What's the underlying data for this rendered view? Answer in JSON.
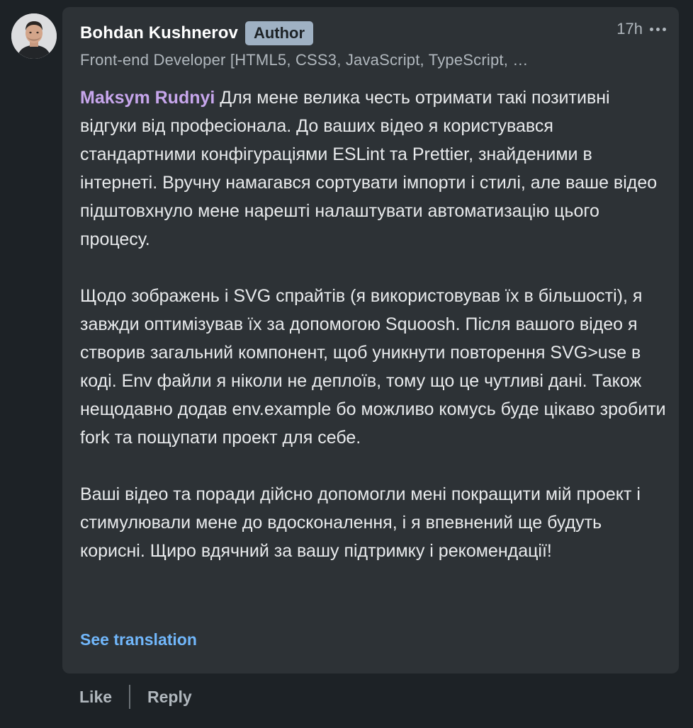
{
  "comment": {
    "author": {
      "name": "Bohdan Kushnerov",
      "badge": "Author",
      "headline": "Front-end Developer [HTML5, CSS3, JavaScript, TypeScript, …"
    },
    "timestamp": "17h",
    "mention": "Maksym Rudnyi",
    "paragraphs": [
      " Для мене велика честь отримати такі позитивні відгуки від професіонала. До ваших відео я користувався стандартними конфігураціями ESLint та Prettier, знайденими в інтернеті. Вручну намагався сортувати імпорти і стилі, але ваше відео підштовхнуло мене нарешті налаштувати автоматизацію цього процесу.",
      "Щодо зображень і SVG спрайтів (я використовував їх в більшості), я завжди оптимізував їх за допомогою Squoosh. Після вашого відео я створив загальний компонент, щоб уникнути повторення SVG>use в коді. Env файли я ніколи не деплоїв, тому що це чутливі дані. Також нещодавно додав env.example бо можливо комусь буде цікаво зробити fork та пощупати проект для себе.",
      "Ваші відео та поради дійсно допомогли мені покращити мій проект і стимулювали мене до вдосконалення, і я впевнений ще будуть корисні. Щиро вдячний за вашу підтримку і рекомендації!"
    ],
    "see_translation": "See translation"
  },
  "actions": {
    "like": "Like",
    "reply": "Reply"
  },
  "icons": {
    "more": "more-horizontal-icon",
    "avatar": "profile-photo"
  },
  "colors": {
    "page_bg": "#1d2226",
    "bubble_bg": "#2d3236",
    "mention": "#c7a6ec",
    "link": "#71b7fb",
    "badge_bg": "#9fb1c3"
  }
}
